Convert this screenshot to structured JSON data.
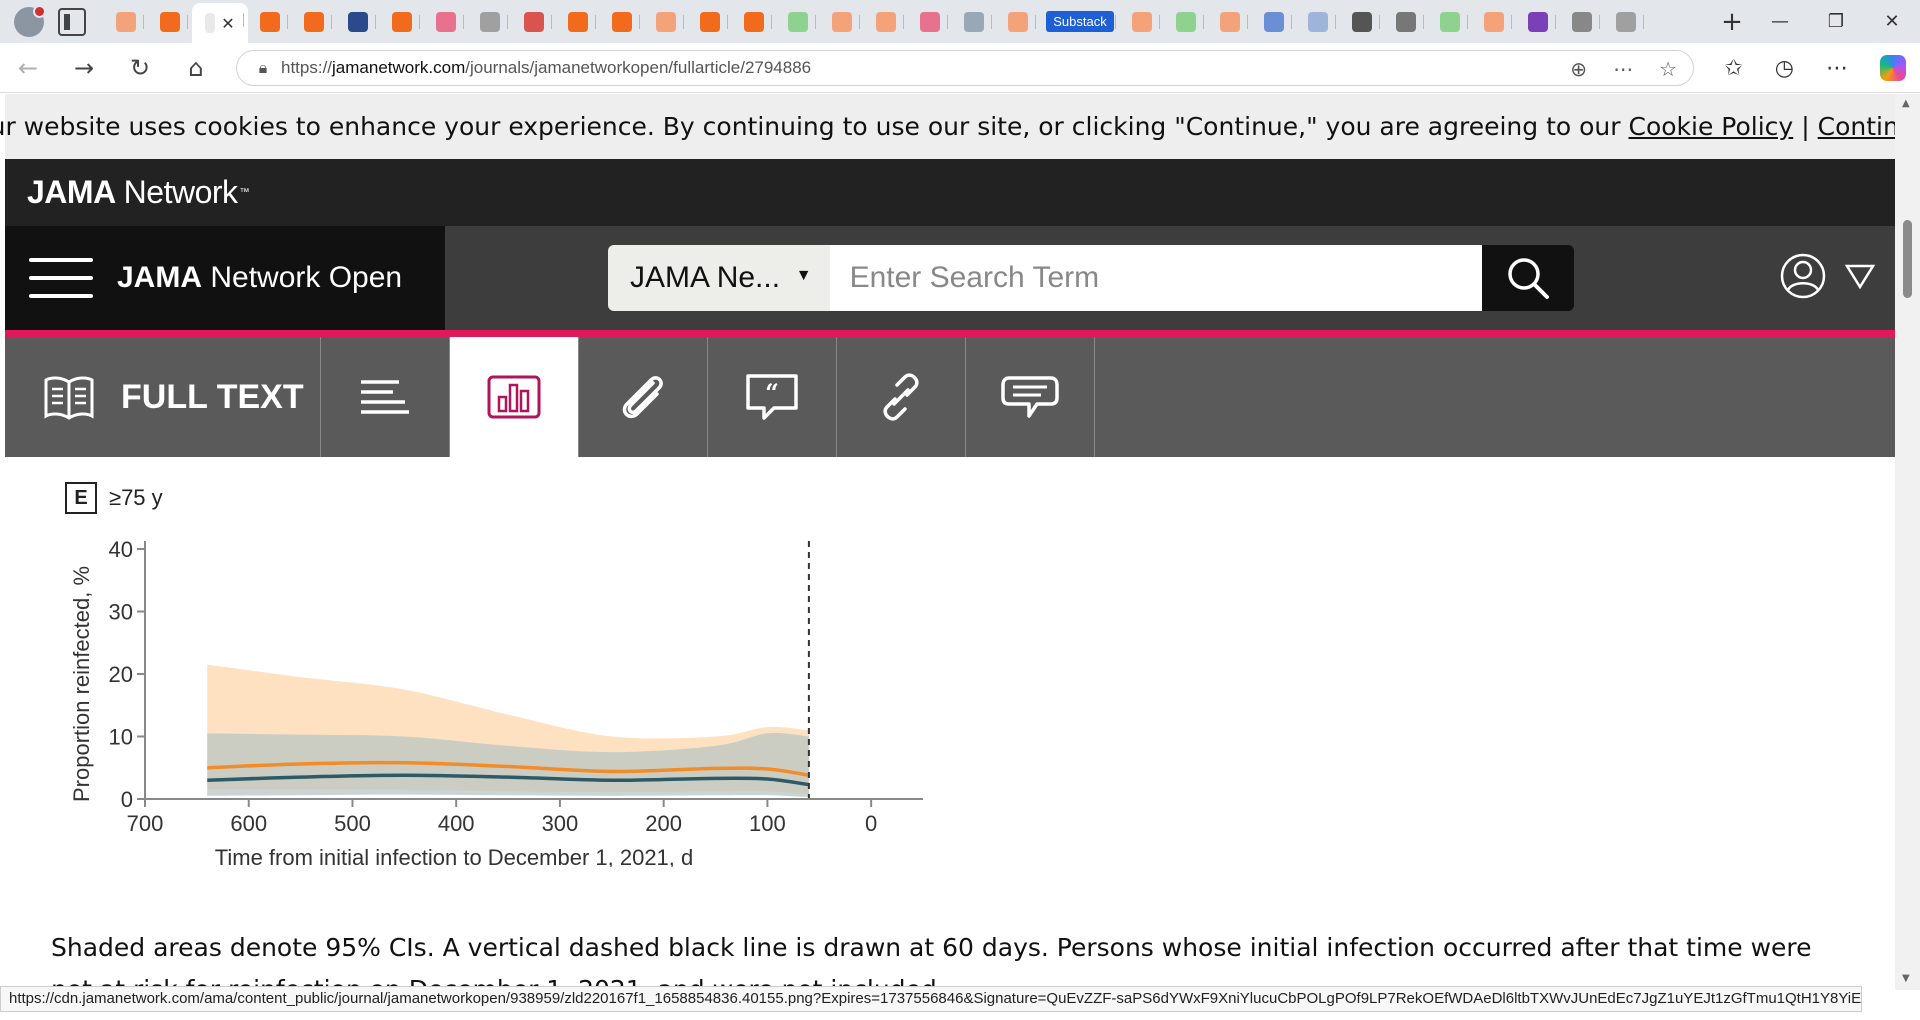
{
  "browser": {
    "active_tab_close": "✕",
    "substack_tab": "Substack",
    "new_tab": "+",
    "url_host": "jamanetwork.com",
    "url_prefix": "https://",
    "url_path": "/journals/jamanetworkopen/fullarticle/2794886",
    "status_url": "https://cdn.jamanetwork.com/ama/content_public/journal/jamanetworkopen/938959/zld220167f1_1658854836.40155.png?Expires=1737556846&Signature=QuEvZZF-saPS6dYWxF9XniYlucuCbPOLgPOf9LP7RekOEfWDAeDl6ltbTXWvJUnEdEc7JgZ1uYEJt1zGfTmu1QtH1Y8YiEpK3gp..."
  },
  "cookie": {
    "message": "Our website uses cookies to enhance your experience. By continuing to use our site, or clicking \"Continue,\" you are agreeing to our",
    "policy_link": "Cookie Policy",
    "separator": "|",
    "continue_link": "Continue"
  },
  "header": {
    "brand_bold": "JAMA",
    "brand_rest": "Network",
    "brand_tm": "™",
    "journal_bold": "JAMA",
    "journal_rest": "Network Open",
    "search_scope": "JAMA Ne...",
    "search_placeholder": "Enter Search Term"
  },
  "article_tabs": {
    "full_text": "FULL TEXT"
  },
  "figure": {
    "panel_letter": "E",
    "panel_title": "≥75 y",
    "caption": "Shaded areas denote 95% CIs. A vertical dashed black line is drawn at 60 days. Persons whose initial infection occurred after that time were not at risk for reinfection on December 1, 2021, and were not included."
  },
  "chart_data": {
    "type": "line",
    "title": "≥75 y",
    "xlabel": "Time from initial infection to December 1, 2021, d",
    "ylabel": "Proportion reinfected, %",
    "xlim": [
      700,
      -50
    ],
    "ylim": [
      0,
      40
    ],
    "x_ticks": [
      700,
      600,
      500,
      400,
      300,
      200,
      100,
      0
    ],
    "y_ticks": [
      0,
      10,
      20,
      30,
      40
    ],
    "reference_line": {
      "x": 60,
      "style": "dashed",
      "color": "#333333"
    },
    "grid": false,
    "series": [
      {
        "color": "#f28c28",
        "band_color": "#fddcb5",
        "x": [
          640,
          550,
          450,
          350,
          250,
          150,
          100,
          60
        ],
        "values": [
          5,
          5.6,
          5.8,
          5.2,
          4.4,
          4.9,
          4.8,
          3.8
        ],
        "lower": [
          1.5,
          1.5,
          1.5,
          1.2,
          1.1,
          1.2,
          1.2,
          0.8
        ],
        "upper": [
          21.5,
          19.5,
          17.5,
          13.5,
          10,
          10,
          11.5,
          11
        ]
      },
      {
        "color": "#2e5a68",
        "band_color": "#b9c6c4",
        "x": [
          640,
          550,
          450,
          350,
          250,
          150,
          100,
          60
        ],
        "values": [
          3,
          3.5,
          3.8,
          3.5,
          3,
          3.3,
          3.2,
          2.3
        ],
        "lower": [
          0.5,
          0.6,
          0.7,
          0.6,
          0.5,
          0.6,
          0.6,
          0.3
        ],
        "upper": [
          10.5,
          10.3,
          10,
          8.5,
          7.5,
          8.5,
          10.5,
          10
        ]
      }
    ]
  }
}
